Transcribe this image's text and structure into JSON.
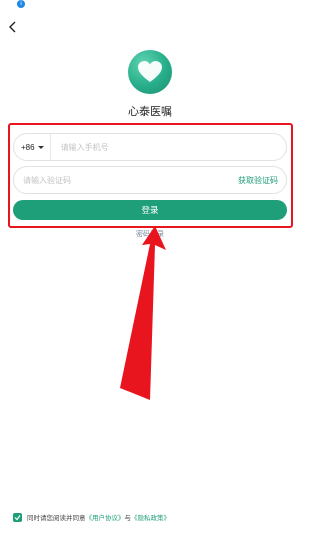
{
  "status": {
    "indicator": "i"
  },
  "header": {
    "back_icon": "chevron-left-icon"
  },
  "app": {
    "name": "心泰医嘱",
    "logo_icon": "heart-logo-icon"
  },
  "login": {
    "country_code": "+86",
    "phone_placeholder": "请输入手机号",
    "code_placeholder": "请输入验证码",
    "get_code_label": "获取验证码",
    "login_button_label": "登录",
    "alt_login_label": "密码登录"
  },
  "agreement": {
    "checked": true,
    "prefix": "同时请您阅读并同意",
    "user_agreement": "《用户协议》",
    "connector": "与",
    "privacy_policy": "《隐私政策》"
  },
  "colors": {
    "accent": "#1f9e7a",
    "highlight": "#e8141e"
  }
}
